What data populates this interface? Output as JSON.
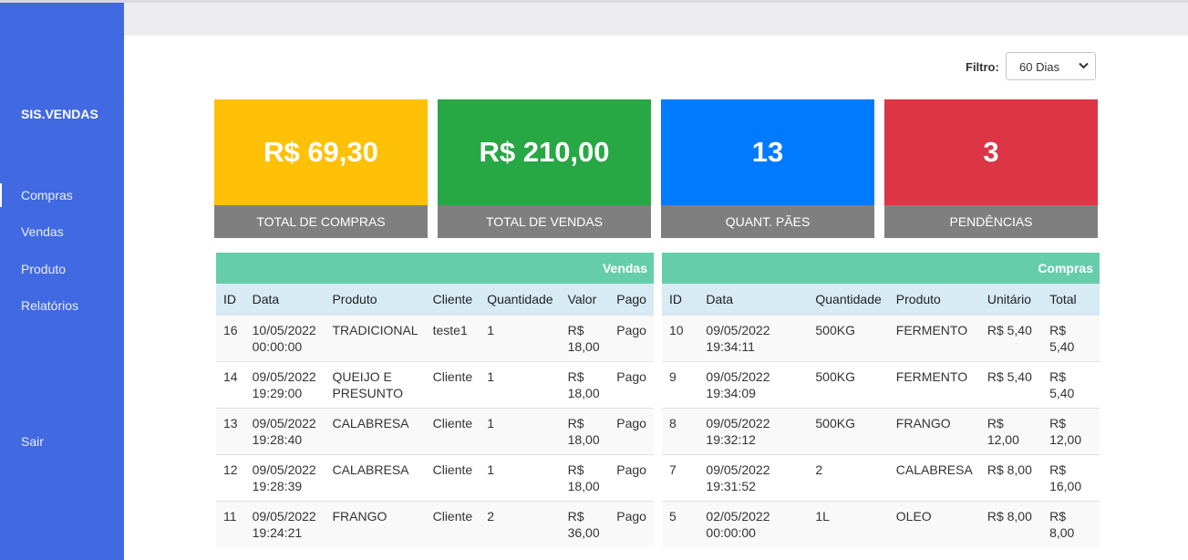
{
  "sidebar": {
    "brand": "SIS.VENDAS",
    "items": [
      {
        "label": "Compras",
        "active": true
      },
      {
        "label": "Vendas",
        "active": false
      },
      {
        "label": "Produto",
        "active": false
      },
      {
        "label": "Relatórios",
        "active": false
      }
    ],
    "logout": "Sair",
    "bg_color": "#4169e1"
  },
  "filter": {
    "label": "Filtro:",
    "selected": "60 Dias"
  },
  "cards": [
    {
      "value": "R$ 69,30",
      "label": "TOTAL DE COMPRAS",
      "color": "#ffc107"
    },
    {
      "value": "R$ 210,00",
      "label": "TOTAL DE VENDAS",
      "color": "#28a745"
    },
    {
      "value": "13",
      "label": "QUANT. PÃES",
      "color": "#007bff"
    },
    {
      "value": "3",
      "label": "PENDÊNCIAS",
      "color": "#dc3545"
    }
  ],
  "vendas": {
    "title": "Vendas",
    "columns": [
      "ID",
      "Data",
      "Produto",
      "Cliente",
      "Quantidade",
      "Valor",
      "Pago"
    ],
    "rows": [
      [
        "16",
        "10/05/2022 00:00:00",
        "TRADICIONAL",
        "teste1",
        "1",
        "R$ 18,00",
        "Pago"
      ],
      [
        "14",
        "09/05/2022 19:29:00",
        "QUEIJO E PRESUNTO",
        "Cliente",
        "1",
        "R$ 18,00",
        "Pago"
      ],
      [
        "13",
        "09/05/2022 19:28:40",
        "CALABRESA",
        "Cliente",
        "1",
        "R$ 18,00",
        "Pago"
      ],
      [
        "12",
        "09/05/2022 19:28:39",
        "CALABRESA",
        "Cliente",
        "1",
        "R$ 18,00",
        "Pago"
      ],
      [
        "11",
        "09/05/2022 19:24:21",
        "FRANGO",
        "Cliente",
        "2",
        "R$ 36,00",
        "Pago"
      ]
    ]
  },
  "compras": {
    "title": "Compras",
    "columns": [
      "ID",
      "Data",
      "Quantidade",
      "Produto",
      "Unitário",
      "Total"
    ],
    "rows": [
      [
        "10",
        "09/05/2022 19:34:11",
        "500KG",
        "FERMENTO",
        "R$ 5,40",
        "R$ 5,40"
      ],
      [
        "9",
        "09/05/2022 19:34:09",
        "500KG",
        "FERMENTO",
        "R$ 5,40",
        "R$ 5,40"
      ],
      [
        "8",
        "09/05/2022 19:32:12",
        "500KG",
        "FRANGO",
        "R$ 12,00",
        "R$ 12,00"
      ],
      [
        "7",
        "09/05/2022 19:31:52",
        "2",
        "CALABRESA",
        "R$ 8,00",
        "R$ 16,00"
      ],
      [
        "5",
        "02/05/2022 00:00:00",
        "1L",
        "OLEO",
        "R$ 8,00",
        "R$ 8,00"
      ]
    ]
  },
  "colors": {
    "table_header": "#66cdaa",
    "column_header": "#d7ebf5",
    "card_footer": "#7f7f7f"
  }
}
